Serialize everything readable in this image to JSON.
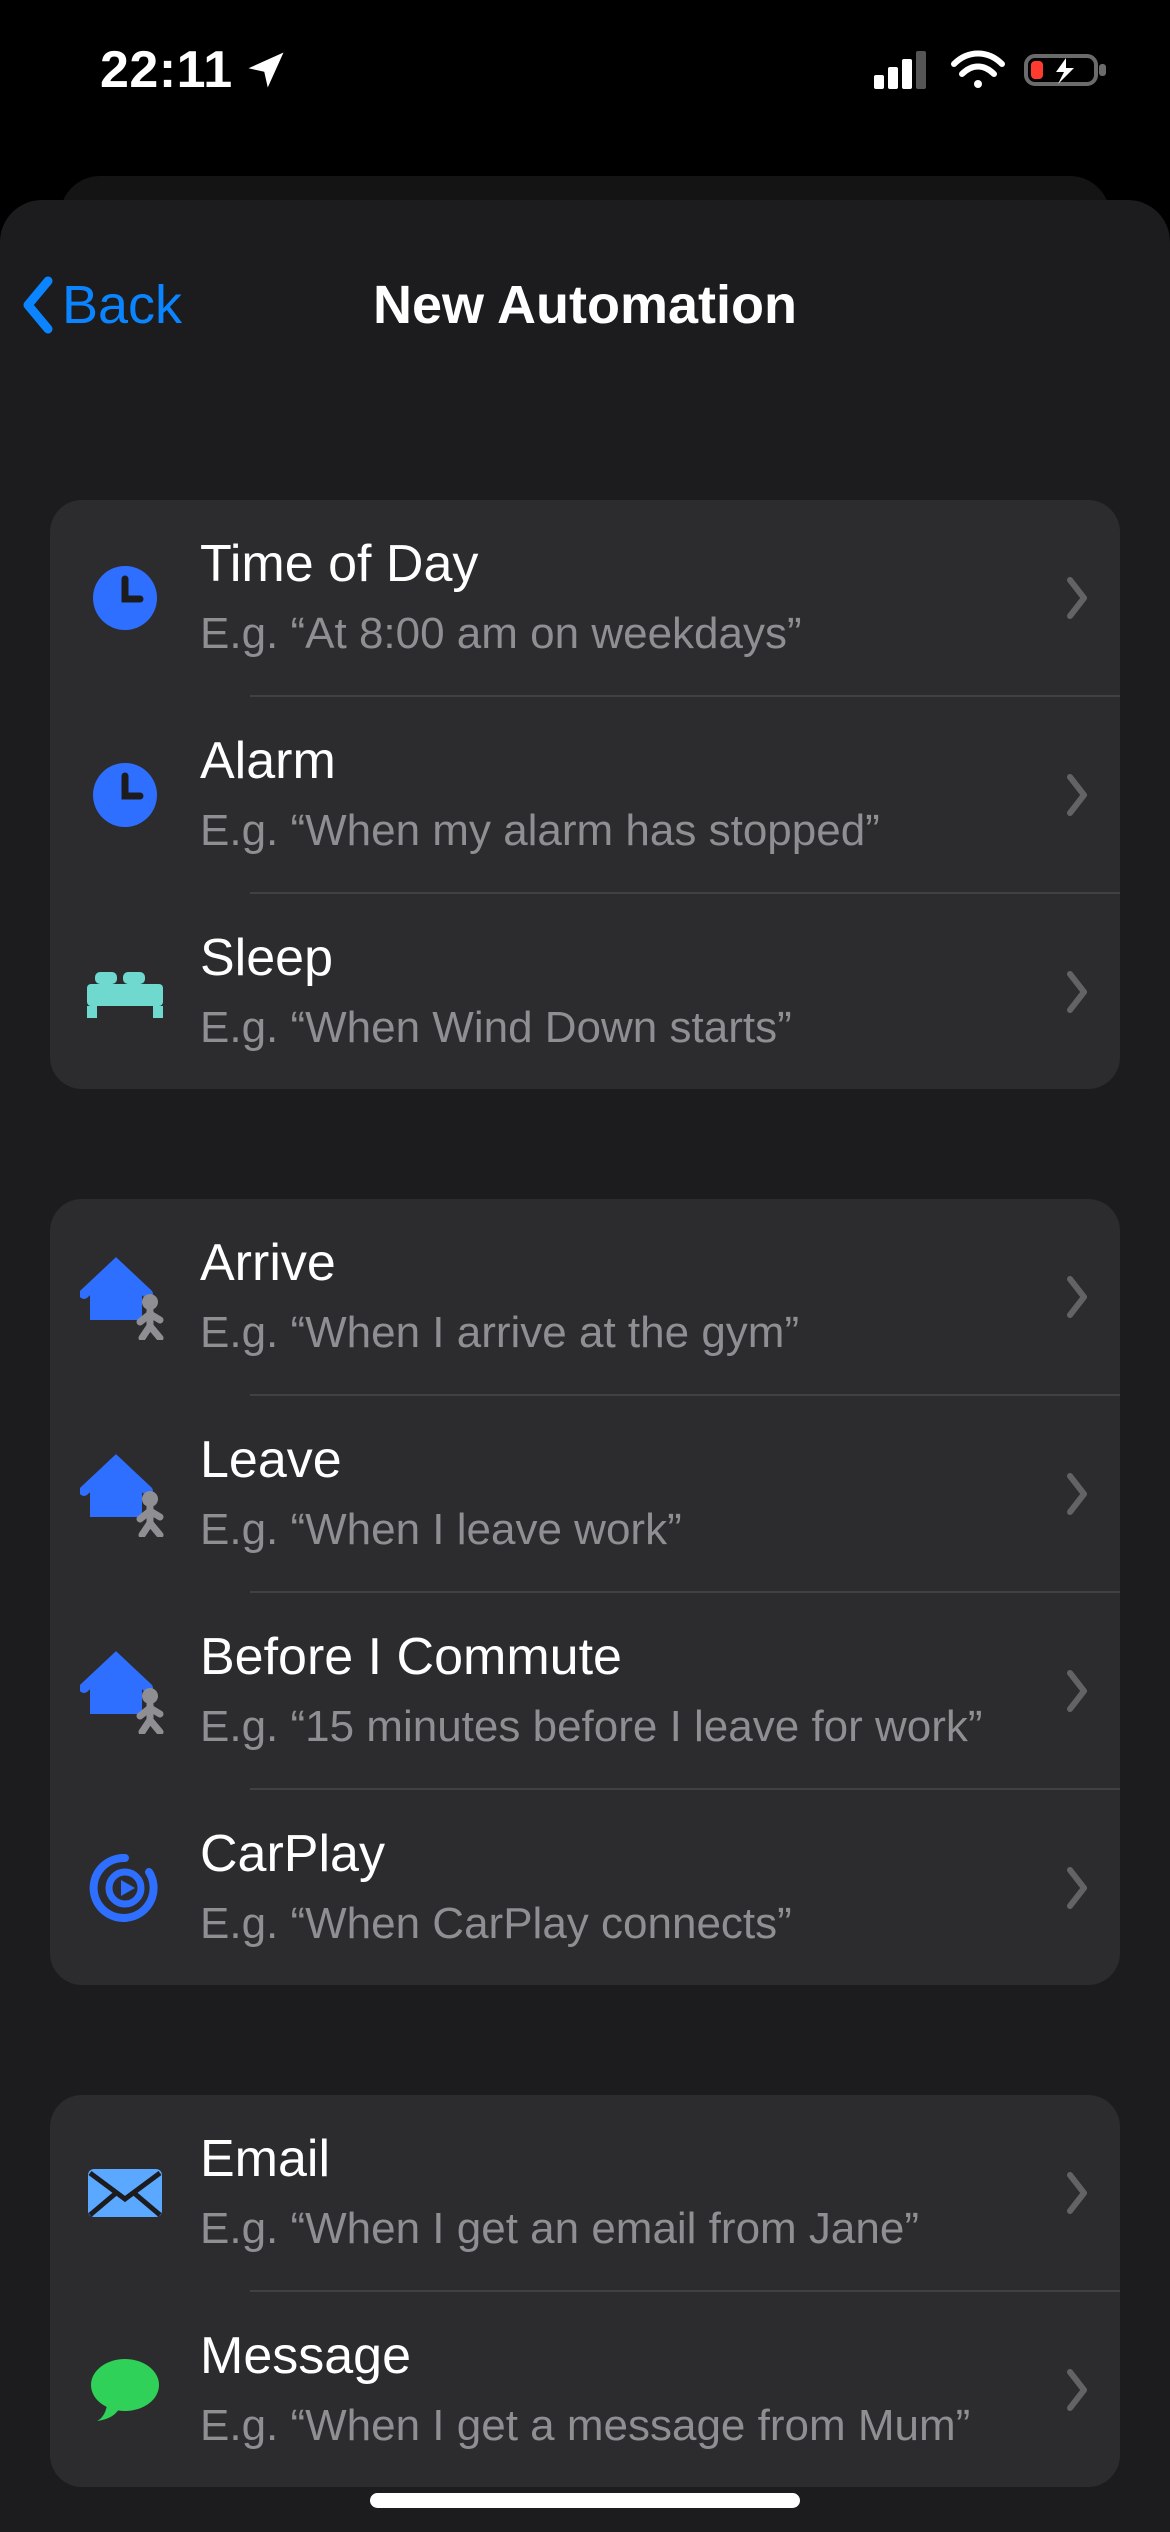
{
  "status": {
    "time": "22:11"
  },
  "nav": {
    "back_label": "Back",
    "title": "New Automation"
  },
  "groups": [
    {
      "rows": [
        {
          "key": "time-of-day",
          "icon": "clock",
          "title": "Time of Day",
          "sub": "E.g. “At 8:00 am on weekdays”"
        },
        {
          "key": "alarm",
          "icon": "clock",
          "title": "Alarm",
          "sub": "E.g. “When my alarm has stopped”"
        },
        {
          "key": "sleep",
          "icon": "bed",
          "title": "Sleep",
          "sub": "E.g. “When Wind Down starts”"
        }
      ]
    },
    {
      "rows": [
        {
          "key": "arrive",
          "icon": "house-person",
          "title": "Arrive",
          "sub": "E.g. “When I arrive at the gym”"
        },
        {
          "key": "leave",
          "icon": "house-person",
          "title": "Leave",
          "sub": "E.g. “When I leave work”"
        },
        {
          "key": "commute",
          "icon": "house-person",
          "title": "Before I Commute",
          "sub": "E.g. “15 minutes before I leave for work”"
        },
        {
          "key": "carplay",
          "icon": "carplay",
          "title": "CarPlay",
          "sub": "E.g. “When CarPlay connects”"
        }
      ]
    },
    {
      "rows": [
        {
          "key": "email",
          "icon": "mail",
          "title": "Email",
          "sub": "E.g. “When I get an email from Jane”"
        },
        {
          "key": "message",
          "icon": "message",
          "title": "Message",
          "sub": "E.g. “When I get a message from Mum”"
        }
      ]
    }
  ],
  "colors": {
    "accent": "#0a84ff",
    "teal": "#6fd8cf",
    "gray_person": "#8e8e93",
    "mail": "#5aa8ff",
    "message": "#30d158"
  }
}
